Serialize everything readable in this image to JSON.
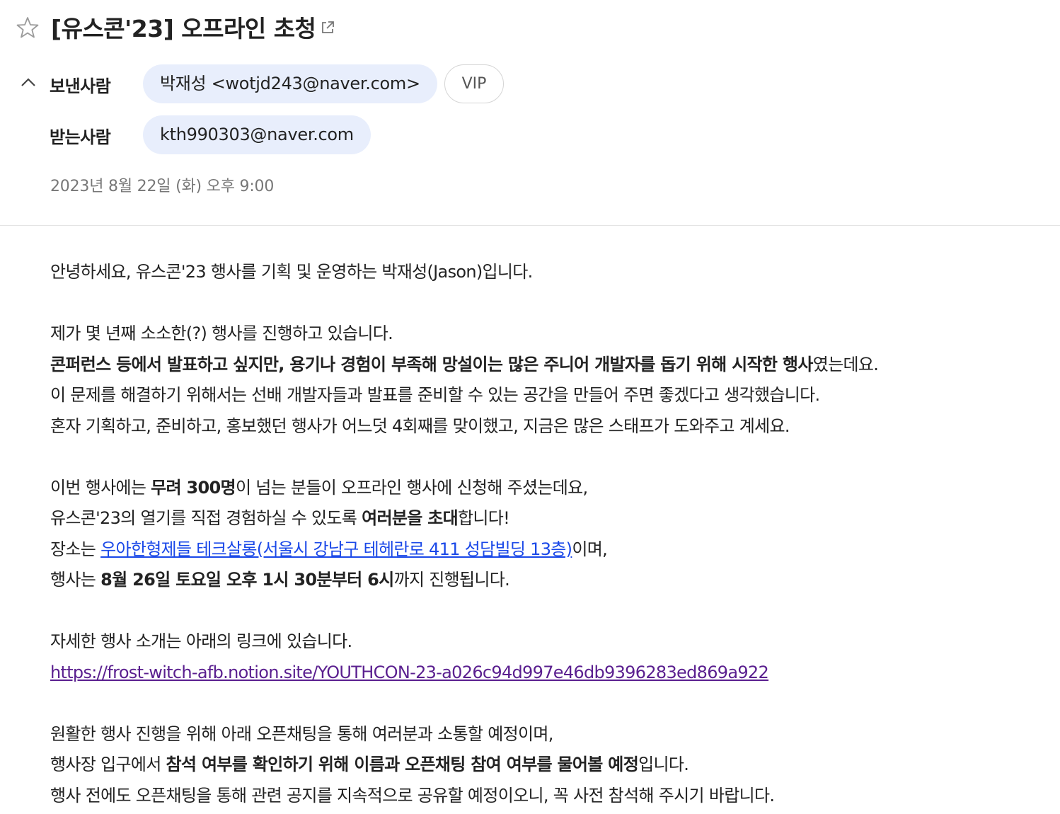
{
  "mail": {
    "subject": "[유스콘'23] 오프라인 초청",
    "sender_label": "보낸사람",
    "sender": "박재성 <wotjd243@naver.com>",
    "vip_label": "VIP",
    "recipient_label": "받는사람",
    "recipient": "kth990303@naver.com",
    "date": "2023년 8월 22일 (화) 오후 9:00"
  },
  "body": {
    "p1": "안녕하세요, 유스콘'23 행사를 기획 및 운영하는 박재성(Jason)입니다.",
    "p2_1": "제가 몇 년째 소소한(?) 행사를 진행하고 있습니다.",
    "p2_2_bold": "콘퍼런스 등에서 발표하고 싶지만, 용기나 경험이 부족해 망설이는 많은 주니어 개발자를 돕기 위해 시작한 행사",
    "p2_2_rest": "였는데요.",
    "p2_3": "이 문제를 해결하기 위해서는 선배 개발자들과 발표를 준비할 수 있는 공간을 만들어 주면 좋겠다고 생각했습니다.",
    "p2_4": "혼자 기획하고, 준비하고, 홍보했던 행사가 어느덧 4회째를 맞이했고, 지금은 많은 스태프가 도와주고 계세요.",
    "p3_1_a": "이번 행사에는 ",
    "p3_1_bold": "무려 300명",
    "p3_1_b": "이 넘는 분들이 오프라인 행사에 신청해 주셨는데요,",
    "p3_2_a": "유스콘'23의 열기를 직접 경험하실 수 있도록 ",
    "p3_2_bold": "여러분을 초대",
    "p3_2_b": "합니다!",
    "p3_3_a": "장소는 ",
    "p3_3_link": "우아한형제들 테크살롱(서울시 강남구 테헤란로 411 성담빌딩 13층)",
    "p3_3_b": "이며,",
    "p3_4_a": "행사는 ",
    "p3_4_bold": "8월 26일 토요일 오후 1시 30분부터 6시",
    "p3_4_b": "까지 진행됩니다.",
    "p4_1": "자세한 행사 소개는 아래의 링크에 있습니다.",
    "p4_link": "https://frost-witch-afb.notion.site/YOUTHCON-23-a026c94d997e46db9396283ed869a922",
    "p5_1": "원활한 행사 진행을 위해 아래 오픈채팅을 통해 여러분과 소통할 예정이며,",
    "p5_2_a": "행사장 입구에서 ",
    "p5_2_bold": "참석 여부를 확인하기 위해 이름과 오픈채팅 참여 여부를 물어볼 예정",
    "p5_2_b": "입니다.",
    "p5_3": "행사 전에도 오픈채팅을 통해 관련 공지를 지속적으로 공유할 예정이오니, 꼭 사전 참석해 주시기 바랍니다."
  }
}
